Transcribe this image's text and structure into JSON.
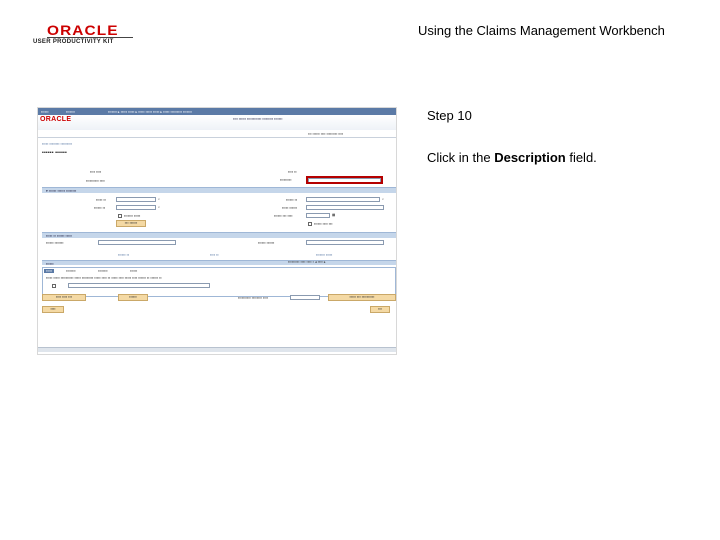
{
  "header": {
    "logo_text": "ORACLE",
    "logo_subtext": "USER PRODUCTIVITY KIT",
    "doc_title": "Using the Claims Management Workbench"
  },
  "instructions": {
    "step": "Step 10",
    "text_before": "Click in the ",
    "text_bold": "Description",
    "text_after": " field."
  },
  "colors": {
    "highlight": "#b50000",
    "nav_bar": "#5b7aa6",
    "section_band": "#c5d6ea",
    "button": "#f4d9a4"
  }
}
